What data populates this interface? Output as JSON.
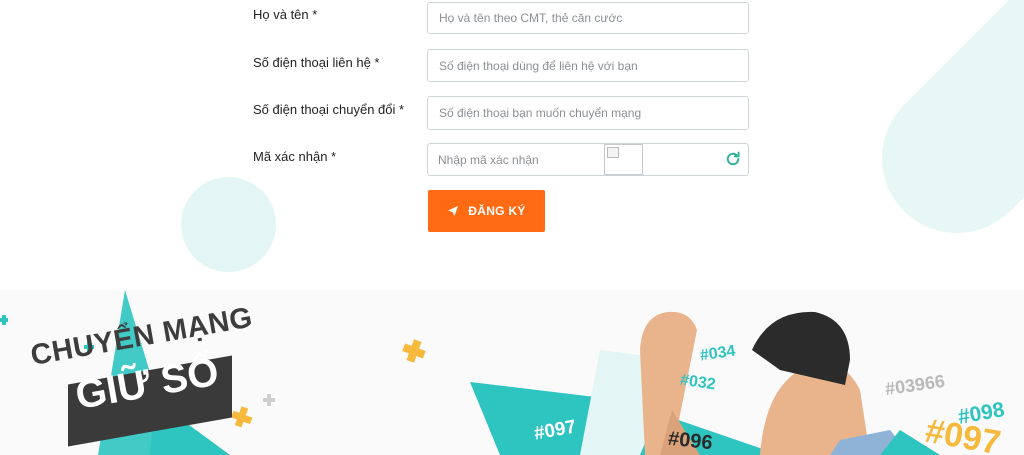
{
  "form": {
    "fields": [
      {
        "label": "Họ và tên *",
        "placeholder": "Họ và tên theo CMT, thẻ căn cước"
      },
      {
        "label": "Số điện thoại liên hệ *",
        "placeholder": "Số điện thoại dùng để liên hệ với bạn"
      },
      {
        "label": "Số điện thoại chuyển đổi *",
        "placeholder": "Số điện thoại bạn muốn chuyển mạng"
      }
    ],
    "captcha": {
      "label": "Mã xác nhận *",
      "placeholder": "Nhập mã xác nhận"
    },
    "submit_label": "ĐĂNG KÝ"
  },
  "banner": {
    "line1": "CHUYỂN MẠNG",
    "line2": "GIỮ SỐ",
    "numbers": [
      "#034",
      "#032",
      "#097",
      "#096",
      "#03966",
      "#098",
      "#097"
    ]
  },
  "colors": {
    "accent": "#ff6a13",
    "teal": "#2ec4c0",
    "mint": "#e3f6f5",
    "yellow": "#f6b93b"
  }
}
